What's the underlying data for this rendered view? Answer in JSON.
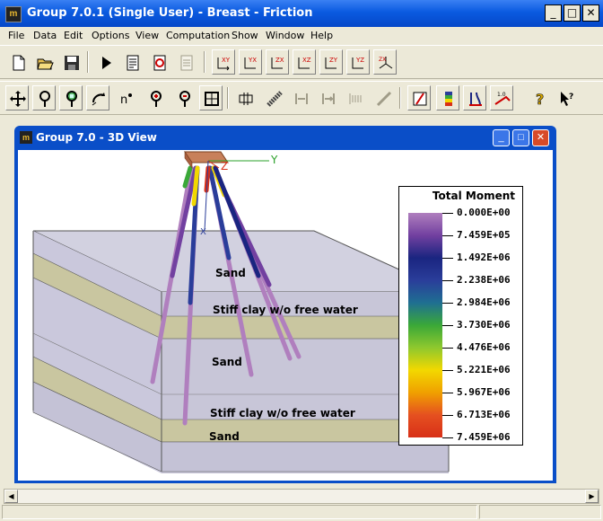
{
  "app": {
    "title": "Group 7.0.1 (Single User) - Breast - Friction",
    "icon": "app-logo-icon",
    "controls": {
      "minimize": "_",
      "maximize": "□",
      "close": "✕"
    }
  },
  "menu": [
    "File",
    "Data",
    "Edit",
    "Options",
    "View",
    "Computation",
    "Show",
    "Window",
    "Help"
  ],
  "toolbar1": [
    {
      "name": "new-file-icon"
    },
    {
      "name": "open-folder-icon"
    },
    {
      "name": "save-disk-icon"
    },
    {
      "name": "run-play-icon"
    },
    {
      "name": "report-text-icon"
    },
    {
      "name": "report-graphic-icon"
    },
    {
      "name": "report-disabled-icon"
    },
    {
      "name": "rotate-xy-icon"
    },
    {
      "name": "rotate-yx-icon"
    },
    {
      "name": "rotate-zx-icon"
    },
    {
      "name": "rotate-xz-icon"
    },
    {
      "name": "rotate-zy-icon"
    },
    {
      "name": "rotate-yz-icon"
    },
    {
      "name": "rotate-isometric-icon"
    }
  ],
  "toolbar2": [
    {
      "name": "pan-move-icon"
    },
    {
      "name": "zoom-icon"
    },
    {
      "name": "zoom-window-icon"
    },
    {
      "name": "rotate-free-icon"
    },
    {
      "name": "node-number-icon"
    },
    {
      "name": "zoom-in-icon"
    },
    {
      "name": "zoom-out-icon"
    },
    {
      "name": "fit-view-icon"
    },
    {
      "name": "pile-cap-icon"
    },
    {
      "name": "pile-section-icon"
    },
    {
      "name": "pile-head-disabled-icon"
    },
    {
      "name": "pile-load-disabled-icon"
    },
    {
      "name": "pile-spring-disabled-icon"
    },
    {
      "name": "slope-disabled-icon"
    },
    {
      "name": "soil-layer-icon"
    },
    {
      "name": "color-legend-icon"
    },
    {
      "name": "deflection-icon"
    },
    {
      "name": "scale-icon"
    },
    {
      "name": "help-icon"
    },
    {
      "name": "context-help-icon"
    }
  ],
  "view": {
    "title": "Group 7.0 - 3D View",
    "controls": {
      "minimize": "_",
      "maximize": "□",
      "close": "✕"
    },
    "axes": {
      "y": "Y",
      "z": "Z",
      "x": "X"
    },
    "soil_labels": [
      "Sand",
      "Stiff clay w/o free water",
      "Sand",
      "Stiff clay w/o free water",
      "Sand"
    ]
  },
  "legend": {
    "title": "Total Moment",
    "values": [
      "0.000E+00",
      "7.459E+05",
      "1.492E+06",
      "2.238E+06",
      "2.984E+06",
      "3.730E+06",
      "4.476E+06",
      "5.221E+06",
      "5.967E+06",
      "6.713E+06",
      "7.459E+06"
    ],
    "colors": [
      "#b07fbe",
      "#7240a0",
      "#1a2580",
      "#2a3d9a",
      "#1f6f92",
      "#3aa838",
      "#8ec82e",
      "#f2d800",
      "#f0a000",
      "#e55020",
      "#d83018"
    ]
  }
}
